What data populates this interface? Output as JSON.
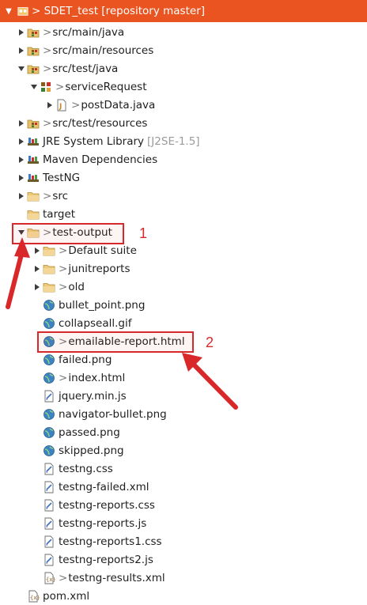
{
  "header": {
    "label": "> SDET_test [repository master]"
  },
  "rows": [
    {
      "kind": "pkgfolder",
      "twisty": "closed",
      "deco": ">",
      "label": "src/main/java",
      "suffix": ""
    },
    {
      "kind": "pkgfolder",
      "twisty": "closed",
      "deco": ">",
      "label": "src/main/resources",
      "suffix": ""
    },
    {
      "kind": "pkgfolder",
      "twisty": "open",
      "deco": ">",
      "label": "src/test/java",
      "suffix": ""
    },
    {
      "kind": "package",
      "twisty": "open",
      "deco": ">",
      "label": "serviceRequest",
      "suffix": ""
    },
    {
      "kind": "java",
      "twisty": "closed",
      "deco": ">",
      "label": "postData.java",
      "suffix": ""
    },
    {
      "kind": "pkgfolder",
      "twisty": "closed",
      "deco": ">",
      "label": "src/test/resources",
      "suffix": ""
    },
    {
      "kind": "library",
      "twisty": "closed",
      "deco": "",
      "label": "JRE System Library",
      "suffix": "[J2SE-1.5]"
    },
    {
      "kind": "library",
      "twisty": "closed",
      "deco": "",
      "label": "Maven Dependencies",
      "suffix": ""
    },
    {
      "kind": "library",
      "twisty": "closed",
      "deco": "",
      "label": "TestNG",
      "suffix": ""
    },
    {
      "kind": "folder",
      "twisty": "closed",
      "deco": ">",
      "label": "src",
      "suffix": ""
    },
    {
      "kind": "folder",
      "twisty": "none",
      "deco": "",
      "label": "target",
      "suffix": ""
    },
    {
      "kind": "folder",
      "twisty": "open",
      "deco": ">",
      "label": "test-output",
      "suffix": ""
    },
    {
      "kind": "folder",
      "twisty": "closed",
      "deco": ">",
      "label": "Default suite",
      "suffix": ""
    },
    {
      "kind": "folder",
      "twisty": "closed",
      "deco": ">",
      "label": "junitreports",
      "suffix": ""
    },
    {
      "kind": "folder",
      "twisty": "closed",
      "deco": ">",
      "label": "old",
      "suffix": ""
    },
    {
      "kind": "web",
      "twisty": "none",
      "deco": "",
      "label": "bullet_point.png",
      "suffix": ""
    },
    {
      "kind": "web",
      "twisty": "none",
      "deco": "",
      "label": "collapseall.gif",
      "suffix": ""
    },
    {
      "kind": "web",
      "twisty": "none",
      "deco": ">",
      "label": "emailable-report.html",
      "suffix": ""
    },
    {
      "kind": "web",
      "twisty": "none",
      "deco": "",
      "label": "failed.png",
      "suffix": ""
    },
    {
      "kind": "web",
      "twisty": "none",
      "deco": ">",
      "label": "index.html",
      "suffix": ""
    },
    {
      "kind": "text",
      "twisty": "none",
      "deco": "",
      "label": "jquery.min.js",
      "suffix": ""
    },
    {
      "kind": "web",
      "twisty": "none",
      "deco": "",
      "label": "navigator-bullet.png",
      "suffix": ""
    },
    {
      "kind": "web",
      "twisty": "none",
      "deco": "",
      "label": "passed.png",
      "suffix": ""
    },
    {
      "kind": "web",
      "twisty": "none",
      "deco": "",
      "label": "skipped.png",
      "suffix": ""
    },
    {
      "kind": "text",
      "twisty": "none",
      "deco": "",
      "label": "testng.css",
      "suffix": ""
    },
    {
      "kind": "text",
      "twisty": "none",
      "deco": "",
      "label": "testng-failed.xml",
      "suffix": ""
    },
    {
      "kind": "text",
      "twisty": "none",
      "deco": "",
      "label": "testng-reports.css",
      "suffix": ""
    },
    {
      "kind": "text",
      "twisty": "none",
      "deco": "",
      "label": "testng-reports.js",
      "suffix": ""
    },
    {
      "kind": "text",
      "twisty": "none",
      "deco": "",
      "label": "testng-reports1.css",
      "suffix": ""
    },
    {
      "kind": "text",
      "twisty": "none",
      "deco": "",
      "label": "testng-reports2.js",
      "suffix": ""
    },
    {
      "kind": "xml",
      "twisty": "none",
      "deco": ">",
      "label": "testng-results.xml",
      "suffix": ""
    },
    {
      "kind": "xml",
      "twisty": "none",
      "deco": "",
      "label": "pom.xml",
      "suffix": ""
    }
  ],
  "annotations": {
    "label1": "1",
    "label2": "2"
  },
  "colors": {
    "header": "#e95420",
    "annotation": "#d9282a",
    "decoration": "#9a9a9a"
  }
}
